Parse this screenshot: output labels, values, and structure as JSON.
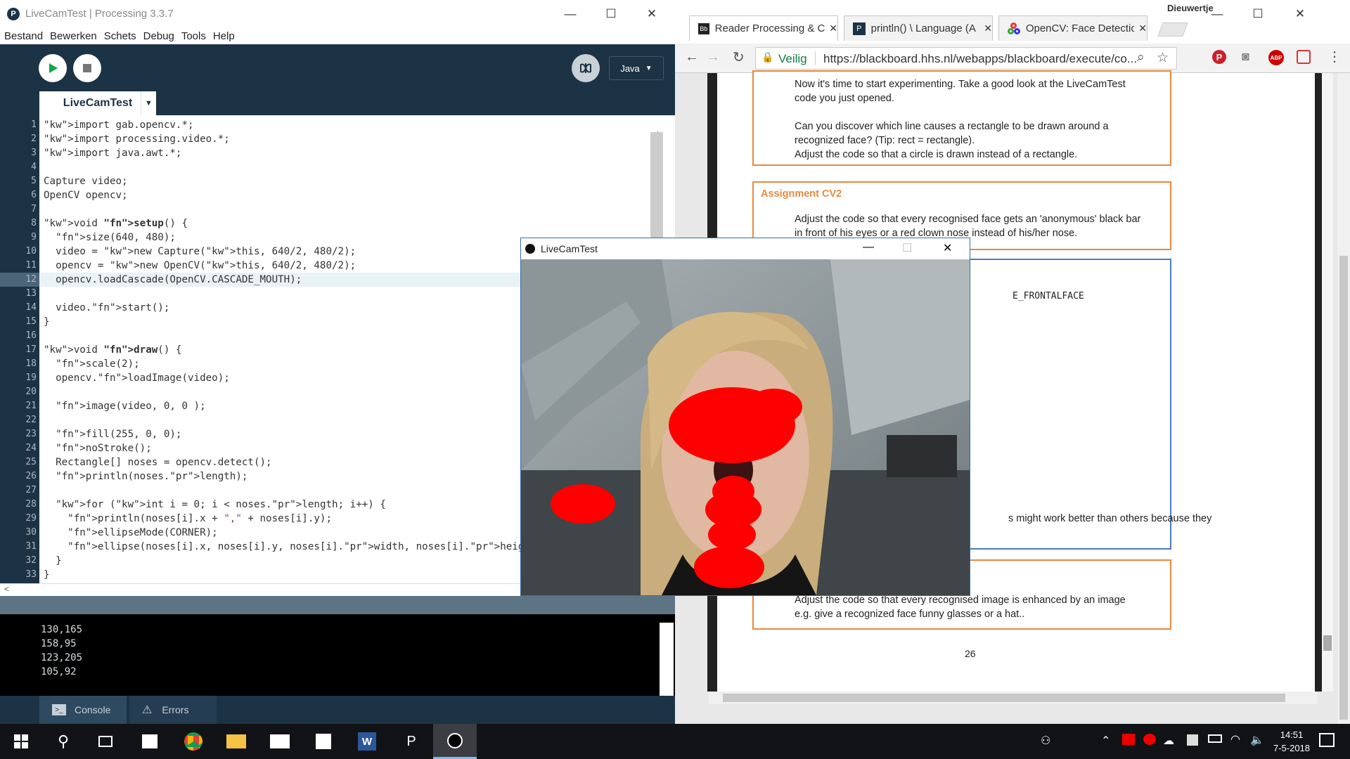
{
  "pde": {
    "title": "LiveCamTest | Processing 3.3.7",
    "menu": [
      "Bestand",
      "Bewerken",
      "Schets",
      "Debug",
      "Tools",
      "Help"
    ],
    "mode": "Java",
    "tab": "LiveCamTest",
    "lines": [
      {
        "n": "1",
        "t": "import gab.opencv.*;"
      },
      {
        "n": "2",
        "t": "import processing.video.*;"
      },
      {
        "n": "3",
        "t": "import java.awt.*;"
      },
      {
        "n": "4",
        "t": ""
      },
      {
        "n": "5",
        "t": "Capture video;"
      },
      {
        "n": "6",
        "t": "OpenCV opencv;"
      },
      {
        "n": "7",
        "t": ""
      },
      {
        "n": "8",
        "t": "void setup() {"
      },
      {
        "n": "9",
        "t": "  size(640, 480);"
      },
      {
        "n": "10",
        "t": "  video = new Capture(this, 640/2, 480/2);"
      },
      {
        "n": "11",
        "t": "  opencv = new OpenCV(this, 640/2, 480/2);"
      },
      {
        "n": "12",
        "t": "  opencv.loadCascade(OpenCV.CASCADE_MOUTH);"
      },
      {
        "n": "13",
        "t": ""
      },
      {
        "n": "14",
        "t": "  video.start();"
      },
      {
        "n": "15",
        "t": "}"
      },
      {
        "n": "16",
        "t": ""
      },
      {
        "n": "17",
        "t": "void draw() {"
      },
      {
        "n": "18",
        "t": "  scale(2);"
      },
      {
        "n": "19",
        "t": "  opencv.loadImage(video);"
      },
      {
        "n": "20",
        "t": ""
      },
      {
        "n": "21",
        "t": "  image(video, 0, 0 );"
      },
      {
        "n": "22",
        "t": ""
      },
      {
        "n": "23",
        "t": "  fill(255, 0, 0);"
      },
      {
        "n": "24",
        "t": "  noStroke();"
      },
      {
        "n": "25",
        "t": "  Rectangle[] noses = opencv.detect();"
      },
      {
        "n": "26",
        "t": "  println(noses.length);"
      },
      {
        "n": "27",
        "t": ""
      },
      {
        "n": "28",
        "t": "  for (int i = 0; i < noses.length; i++) {"
      },
      {
        "n": "29",
        "t": "    println(noses[i].x + \",\" + noses[i].y);"
      },
      {
        "n": "30",
        "t": "    ellipseMode(CORNER);"
      },
      {
        "n": "31",
        "t": "    ellipse(noses[i].x, noses[i].y, noses[i].width, noses[i].height);"
      },
      {
        "n": "32",
        "t": "  }"
      },
      {
        "n": "33",
        "t": "}"
      }
    ],
    "console": [
      "130,165",
      "158,95",
      "123,205",
      "105,92"
    ],
    "console_tab": "Console",
    "errors_tab": "Errors"
  },
  "chrome": {
    "profile": "Dieuwertje",
    "tabs": [
      "Reader Processing & C",
      "println() \\ Language (A",
      "OpenCV: Face Detectio"
    ],
    "secure": "Veilig",
    "url": "https://blackboard.hhs.nl/webapps/blackboard/execute/co...",
    "doc": {
      "box1": [
        "Now it's time to start experimenting. Take a good look at the LiveCamTest",
        "code you just opened.",
        "Can you discover which line causes a rectangle to be drawn around a",
        "recognized face? (Tip: rect = rectangle).",
        "Adjust the code so that a circle is drawn instead of a rectangle."
      ],
      "cv2_title": "Assignment CV2",
      "cv2": [
        "Adjust the code so that every recognised face gets an 'anonymous' black bar",
        "in front of his eyes or a red clown nose instead of his/her nose."
      ],
      "box3_code": "E_FRONTALFACE",
      "box3_text": "s might work better than others because they",
      "box4": [
        "Adjust the code so that every recognised image is enhanced by an image",
        "e.g. give a recognized face funny glasses or a hat.."
      ],
      "page": "26"
    }
  },
  "cam": {
    "title": "LiveCamTest"
  },
  "taskbar": {
    "time": "14:51",
    "date": "7-5-2018"
  }
}
